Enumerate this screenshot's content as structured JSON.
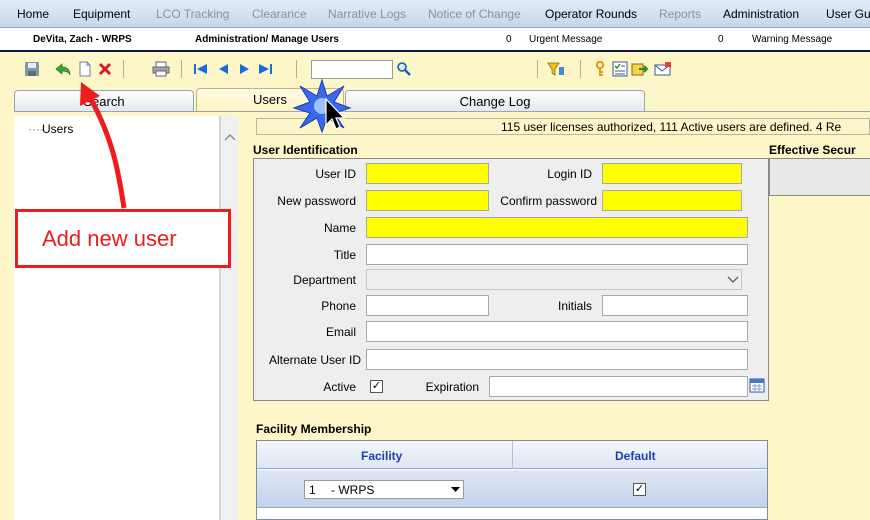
{
  "nav": {
    "items": [
      {
        "label": "Home",
        "enabled": true
      },
      {
        "label": "Equipment",
        "enabled": true
      },
      {
        "label": "LCO Tracking",
        "enabled": false
      },
      {
        "label": "Clearance",
        "enabled": false
      },
      {
        "label": "Narrative Logs",
        "enabled": false
      },
      {
        "label": "Notice of Change",
        "enabled": false
      },
      {
        "label": "Operator Rounds",
        "enabled": true
      },
      {
        "label": "Reports",
        "enabled": false
      },
      {
        "label": "Administration",
        "enabled": true
      },
      {
        "label": "User Gui",
        "enabled": true
      }
    ]
  },
  "status": {
    "user": "DeVita, Zach - WRPS",
    "page": "Administration/ Manage Users",
    "urgent_count": "0",
    "urgent_label": "Urgent Message",
    "warning_count": "0",
    "warning_label": "Warning Message"
  },
  "toolbar": {
    "icons": [
      "save-icon",
      "undo-icon",
      "new-document-icon",
      "delete-icon",
      "print-icon",
      "first-record-icon",
      "previous-record-icon",
      "next-record-icon",
      "last-record-icon",
      "search-icon",
      "filter-icon",
      "key-icon",
      "checklist-icon",
      "export-icon",
      "email-icon"
    ],
    "search_value": ""
  },
  "tabs": [
    {
      "label": "Search",
      "active": false
    },
    {
      "label": "Users",
      "active": true
    },
    {
      "label": "Change Log",
      "active": false
    }
  ],
  "tree": {
    "items": [
      {
        "label": "Users"
      }
    ]
  },
  "info": {
    "text": "115 user licenses authorized, 111 Active users are defined. 4 Re"
  },
  "user_identification": {
    "title": "User Identification",
    "labels": {
      "user_id": "User ID",
      "login_id": "Login ID",
      "new_password": "New password",
      "confirm_password": "Confirm password",
      "name": "Name",
      "title": "Title",
      "department": "Department",
      "phone": "Phone",
      "initials": "Initials",
      "email": "Email",
      "alternate_user_id": "Alternate User ID",
      "active": "Active",
      "expiration": "Expiration"
    },
    "values": {
      "user_id": "",
      "login_id": "",
      "new_password": "",
      "confirm_password": "",
      "name": "",
      "title": "",
      "department": "",
      "phone": "",
      "initials": "",
      "email": "",
      "alternate_user_id": "",
      "expiration": ""
    },
    "active_checked": true
  },
  "effective_security": {
    "title": "Effective Secur"
  },
  "facility_membership": {
    "title": "Facility Membership",
    "columns": [
      "Facility",
      "Default"
    ],
    "rows": [
      {
        "facility_number": "1",
        "facility_name": "- WRPS",
        "default": true
      }
    ]
  },
  "annotation": {
    "text": "Add new user",
    "color": "#ee1c1c"
  }
}
